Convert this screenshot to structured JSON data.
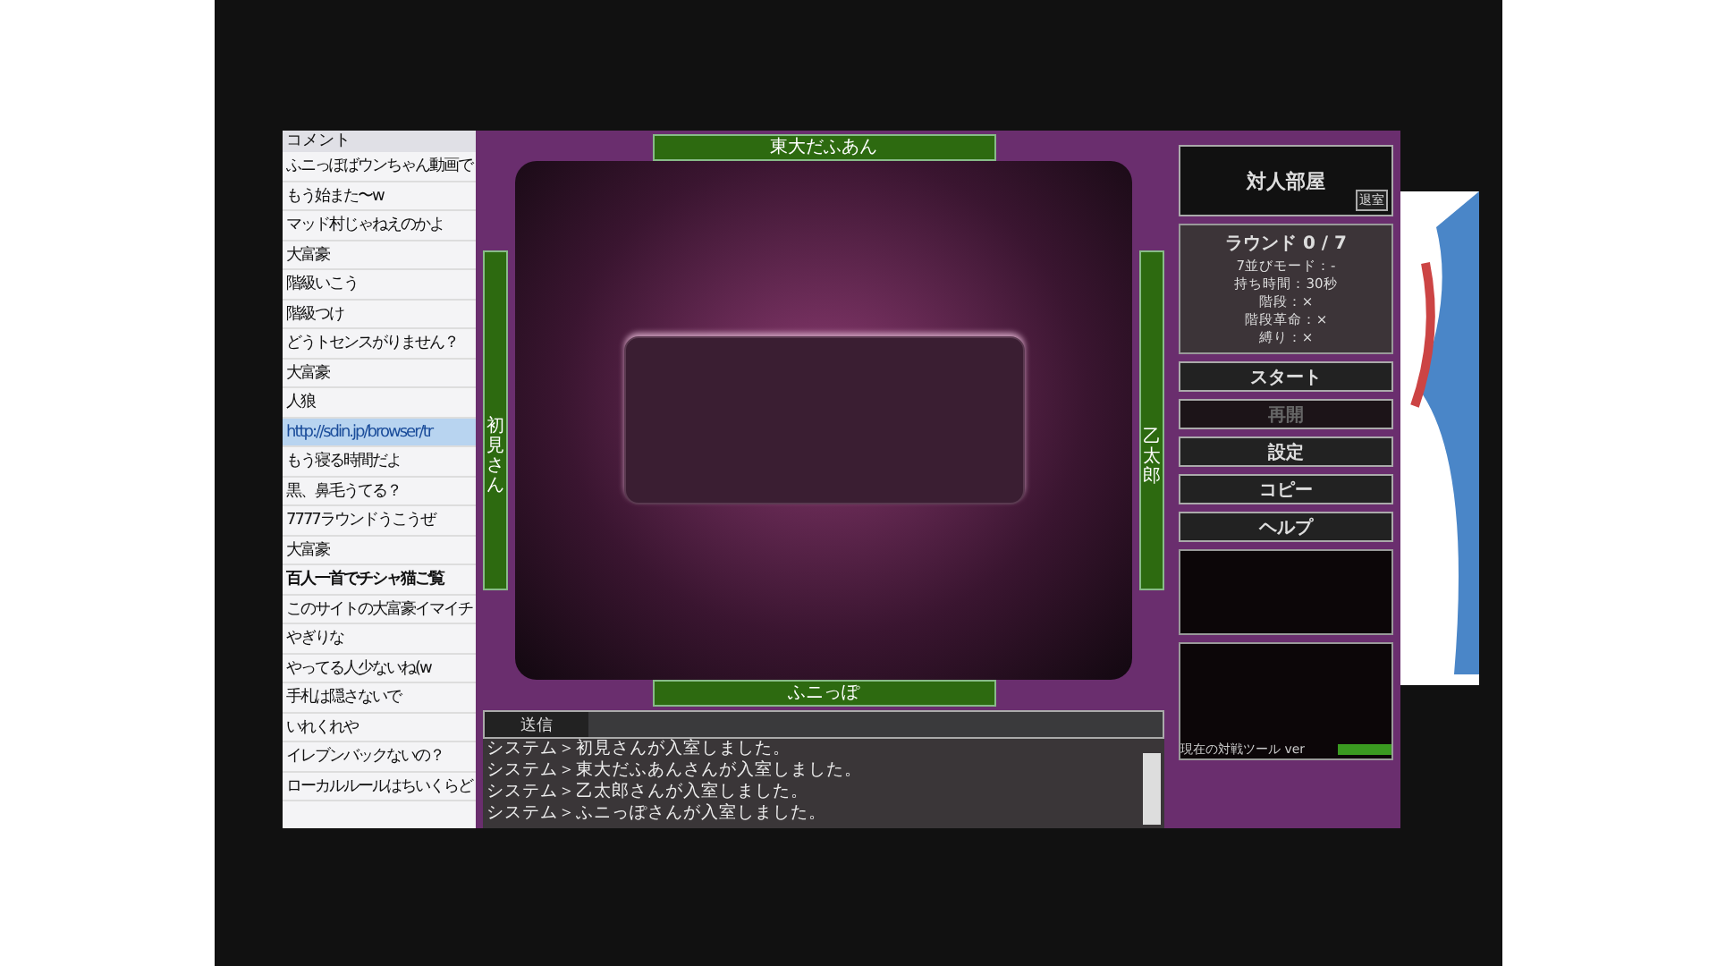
{
  "comments": {
    "header": "コメント",
    "items": [
      {
        "text": "ふニっぽばウンちゃん動画で",
        "selected": false,
        "bold": false
      },
      {
        "text": "もう始また〜w",
        "selected": false,
        "bold": false
      },
      {
        "text": "マッド村じゃねえのかよ",
        "selected": false,
        "bold": false
      },
      {
        "text": "大富豪",
        "selected": false,
        "bold": false
      },
      {
        "text": "階級いこう",
        "selected": false,
        "bold": false
      },
      {
        "text": "階級つけ",
        "selected": false,
        "bold": false
      },
      {
        "text": "どうトセンスがりません？",
        "selected": false,
        "bold": false
      },
      {
        "text": "大富豪",
        "selected": false,
        "bold": false
      },
      {
        "text": "人狼",
        "selected": false,
        "bold": false
      },
      {
        "text": "http://sdin.jp/browser/tr",
        "selected": true,
        "bold": false
      },
      {
        "text": "もう寝る時間だよ",
        "selected": false,
        "bold": false
      },
      {
        "text": "黒、鼻毛うてる？",
        "selected": false,
        "bold": false
      },
      {
        "text": "7777ラウンドうこうぜ",
        "selected": false,
        "bold": false
      },
      {
        "text": "大富豪",
        "selected": false,
        "bold": false
      },
      {
        "text": "百人一首でチシャ猫ご覧",
        "selected": false,
        "bold": true
      },
      {
        "text": "このサイトの大富豪イマイチ",
        "selected": false,
        "bold": false
      },
      {
        "text": "やぎりな",
        "selected": false,
        "bold": false
      },
      {
        "text": "やってる人少ないね(w",
        "selected": false,
        "bold": false
      },
      {
        "text": "手札は隠さないで",
        "selected": false,
        "bold": false
      },
      {
        "text": "いれくれや",
        "selected": false,
        "bold": false
      },
      {
        "text": "イレブンバックないの？",
        "selected": false,
        "bold": false
      },
      {
        "text": "ローカルルールはちいくらど",
        "selected": false,
        "bold": false
      }
    ]
  },
  "table": {
    "top_player": "東大だふあん",
    "left_player": "初見さん",
    "right_player": "乙太郎",
    "bottom_player": "ふニっぽ"
  },
  "chat": {
    "tab": "送信",
    "lines": [
      "システム＞初見さんが入室しました。",
      "システム＞東大だふあんさんが入室しました。",
      "システム＞乙太郎さんが入室しました。",
      "システム＞ふニっぽさんが入室しました。"
    ]
  },
  "room": {
    "title": "対人部屋",
    "exit": "退室"
  },
  "round": {
    "title": "ラウンド 0 / 7",
    "rules": [
      "7並びモード：-",
      "持ち時間：30秒",
      "階段：×",
      "階段革命：×",
      "縛り：×"
    ]
  },
  "buttons": [
    {
      "label": "スタート",
      "disabled": false
    },
    {
      "label": "再開",
      "disabled": true
    },
    {
      "label": "設定",
      "disabled": false
    },
    {
      "label": "コピー",
      "disabled": false
    },
    {
      "label": "ヘルプ",
      "disabled": false
    }
  ],
  "footer": "現在の対戦ツール ver",
  "progress": {
    "level": 1
  }
}
